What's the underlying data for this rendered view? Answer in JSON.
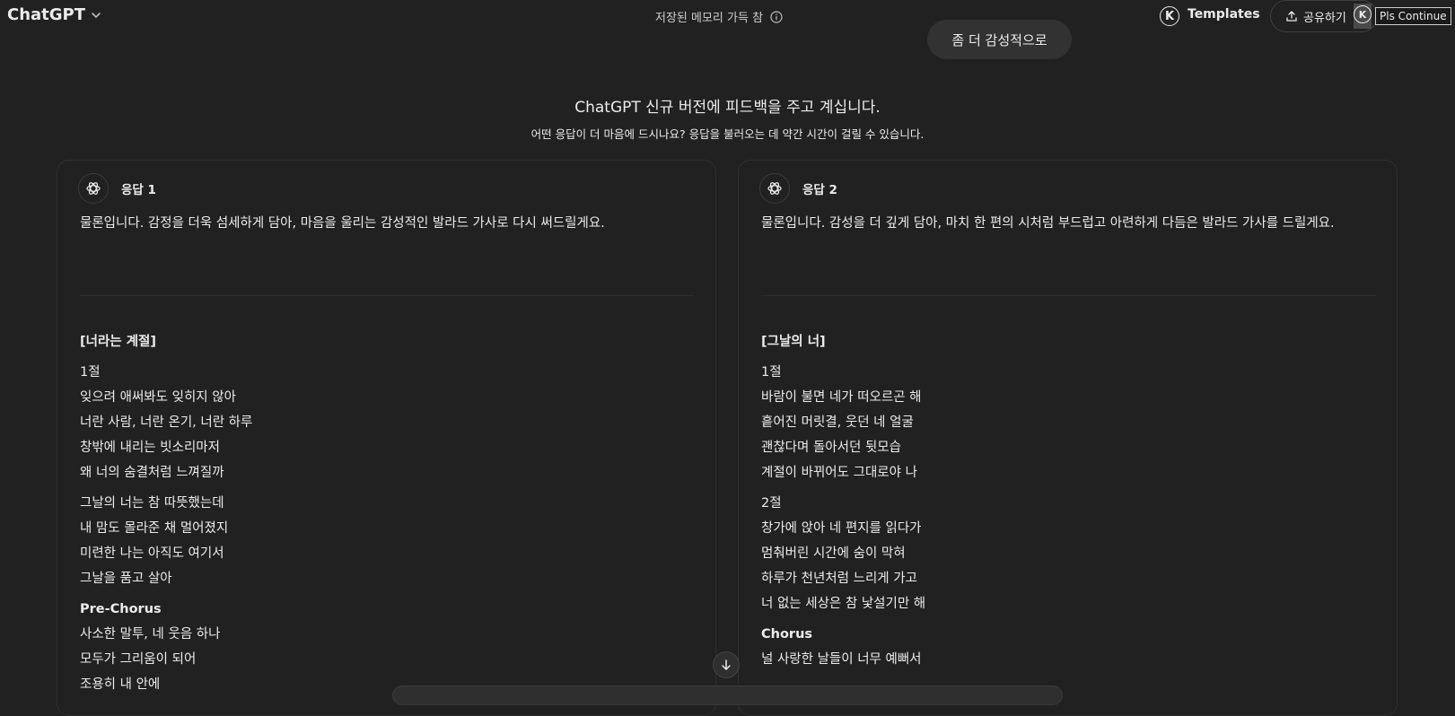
{
  "topbar": {
    "app_title": "ChatGPT",
    "memory_notice": "저장된 메모리 가득 참",
    "templates_label": "Templates",
    "k_letter": "K",
    "share_label": "공유하기",
    "pls_continue_label": "Pls Continue"
  },
  "suggestion": {
    "label": "좀 더 감성적으로"
  },
  "header": {
    "title": "ChatGPT 신규 버전에 피드백을 주고 계십니다.",
    "subtitle": "어떤 응답이 더 마음에 드시나요? 응답을 불러오는 데 약간 시간이 걸릴 수 있습니다."
  },
  "response1": {
    "label": "응답 1",
    "intro": "물론입니다. 감정을 더욱 섬세하게 담아, 마음을 울리는 감성적인 발라드 가사로 다시 써드릴게요.",
    "song_title": "[너라는 계절]",
    "verse1_label": "1절",
    "verse1": [
      "잊으려 애써봐도 잊히지 않아",
      "너란 사람, 너란 온기, 너란 하루",
      "창밖에 내리는 빗소리마저",
      "왜 너의 숨결처럼 느껴질까"
    ],
    "verse1b": [
      "그날의 너는 참 따뜻했는데",
      "내 맘도 몰라준 채 멀어졌지",
      "미련한 나는 아직도 여기서",
      "그날을 품고 살아"
    ],
    "prechorus_label": "Pre-Chorus",
    "prechorus": [
      "사소한 말투, 네 웃음 하나",
      "모두가 그리움이 되어",
      "조용히 내 안에"
    ]
  },
  "response2": {
    "label": "응답 2",
    "intro": "물론입니다. 감성을 더 깊게 담아, 마치 한 편의 시처럼 부드럽고 아련하게 다듬은 발라드 가사를 드릴게요.",
    "song_title": "[그날의 너]",
    "verse1_label": "1절",
    "verse1": [
      "바람이 불면 네가 떠오르곤 해",
      "흩어진 머릿결, 웃던 네 얼굴",
      "괜찮다며 돌아서던 뒷모습",
      "계절이 바뀌어도 그대로야 나"
    ],
    "verse2_label": "2절",
    "verse2": [
      "창가에 앉아 네 편지를 읽다가",
      "멈춰버린 시간에 숨이 막혀",
      "하루가 천년처럼 느리게 가고",
      "너 없는 세상은 참 낯설기만 해"
    ],
    "chorus_label": "Chorus",
    "chorus": [
      "널 사랑한 날들이 너무 예뻐서"
    ]
  }
}
